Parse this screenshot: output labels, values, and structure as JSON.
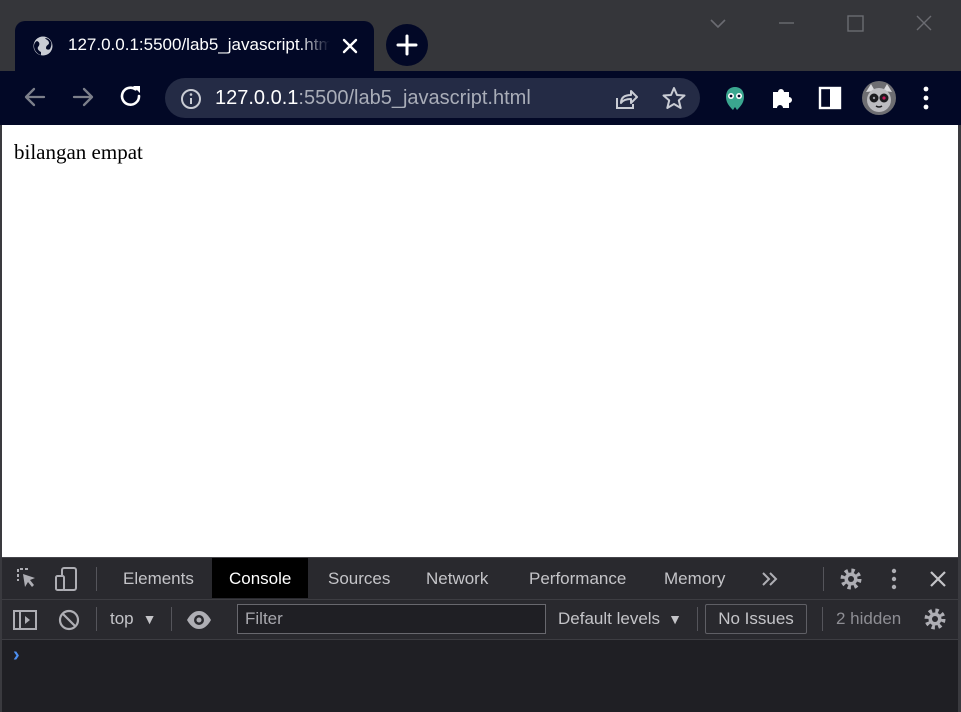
{
  "browser": {
    "tab": {
      "title": "127.0.0.1:5500/lab5_javascript.html",
      "favicon": "globe-icon"
    },
    "address": {
      "host": "127.0.0.1",
      "rest": ":5500/lab5_javascript.html"
    },
    "colors": {
      "toolbar": "#020826",
      "titlebar": "#35363a",
      "omnibox": "#242b45"
    }
  },
  "page": {
    "text": "bilangan empat"
  },
  "devtools": {
    "tabs": [
      "Elements",
      "Console",
      "Sources",
      "Network",
      "Performance",
      "Memory"
    ],
    "active_tab": "Console",
    "context": "top",
    "filter_placeholder": "Filter",
    "levels": "Default levels",
    "issues": "No Issues",
    "hidden": "2 hidden",
    "prompt": "›"
  }
}
